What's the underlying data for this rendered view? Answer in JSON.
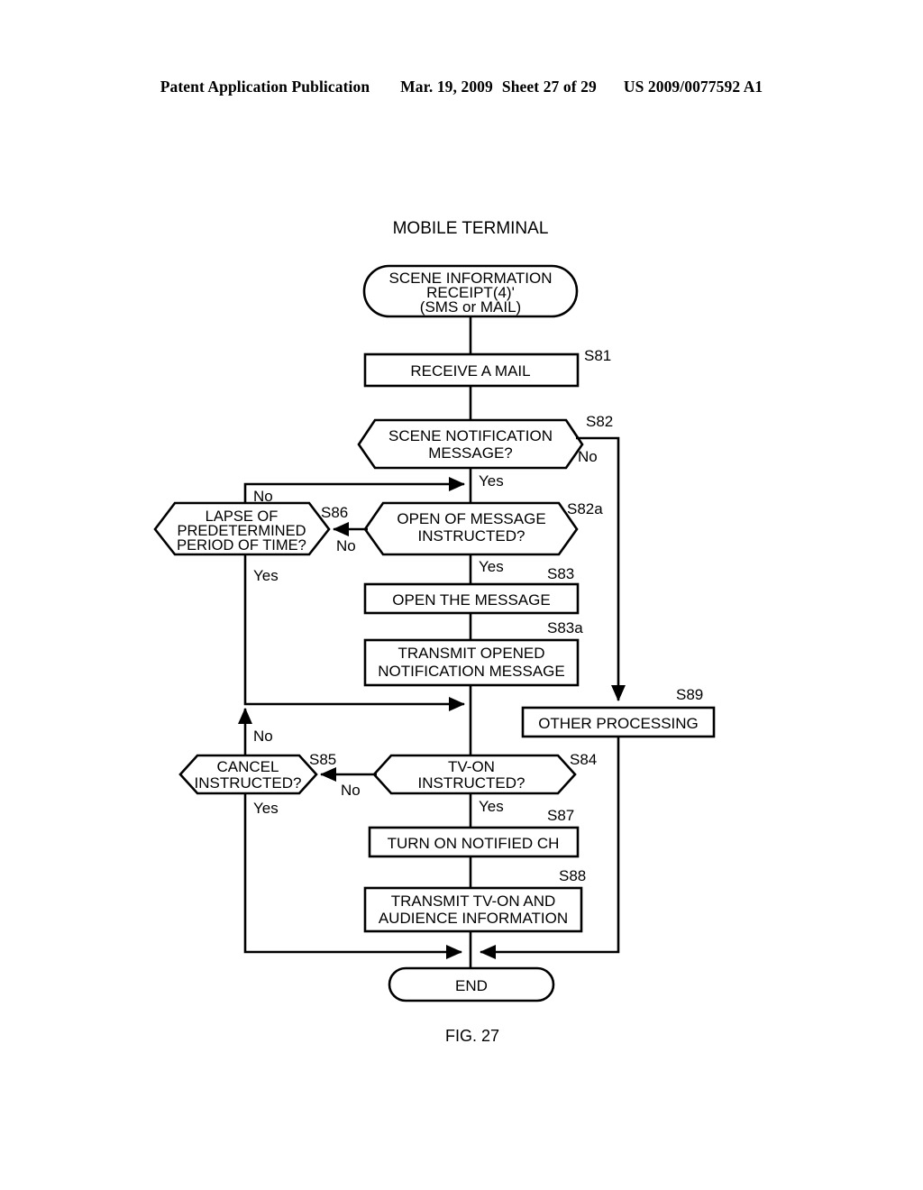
{
  "header": {
    "publication": "Patent Application Publication",
    "date": "Mar. 19, 2009",
    "sheet": "Sheet 27 of 29",
    "patent_number": "US 2009/0077592 A1"
  },
  "figure": {
    "caption": "FIG. 27",
    "column_title": "MOBILE TERMINAL"
  },
  "flowchart": {
    "type": "flowchart",
    "start": {
      "id": "start-terminal",
      "shape": "terminator",
      "lines": [
        "SCENE INFORMATION",
        "RECEIPT(4)'",
        "(SMS or MAIL)"
      ]
    },
    "end": {
      "id": "end-terminal",
      "shape": "terminator",
      "lines": [
        "END"
      ]
    },
    "nodes": [
      {
        "id": "s81",
        "step": "S81",
        "shape": "process",
        "lines": [
          "RECEIVE A MAIL"
        ]
      },
      {
        "id": "s82",
        "step": "S82",
        "shape": "decision",
        "lines": [
          "SCENE NOTIFICATION",
          "MESSAGE?"
        ]
      },
      {
        "id": "s82a",
        "step": "S82a",
        "shape": "decision",
        "lines": [
          "OPEN OF MESSAGE",
          "INSTRUCTED?"
        ]
      },
      {
        "id": "s86",
        "step": "S86",
        "shape": "decision",
        "lines": [
          "LAPSE OF",
          "PREDETERMINED",
          "PERIOD OF TIME?"
        ]
      },
      {
        "id": "s83",
        "step": "S83",
        "shape": "process",
        "lines": [
          "OPEN THE MESSAGE"
        ]
      },
      {
        "id": "s83a",
        "step": "S83a",
        "shape": "process",
        "lines": [
          "TRANSMIT OPENED",
          "NOTIFICATION MESSAGE"
        ]
      },
      {
        "id": "s89",
        "step": "S89",
        "shape": "process",
        "lines": [
          "OTHER PROCESSING"
        ]
      },
      {
        "id": "s84",
        "step": "S84",
        "shape": "decision",
        "lines": [
          "TV-ON",
          "INSTRUCTED?"
        ]
      },
      {
        "id": "s85",
        "step": "S85",
        "shape": "decision",
        "lines": [
          "CANCEL",
          "INSTRUCTED?"
        ]
      },
      {
        "id": "s87",
        "step": "S87",
        "shape": "process",
        "lines": [
          "TURN ON NOTIFIED CH"
        ]
      },
      {
        "id": "s88",
        "step": "S88",
        "shape": "process",
        "lines": [
          "TRANSMIT TV-ON AND",
          "AUDIENCE INFORMATION"
        ]
      }
    ],
    "branch_labels": {
      "s82_yes": "Yes",
      "s82_no": "No",
      "s82a_yes": "Yes",
      "s82a_no": "No",
      "s86_yes": "Yes",
      "s86_no": "No",
      "s84_yes": "Yes",
      "s84_no": "No",
      "s85_yes": "Yes",
      "s85_no": "No"
    },
    "edges": [
      {
        "from": "start-terminal",
        "to": "s81",
        "label": ""
      },
      {
        "from": "s81",
        "to": "s82",
        "label": ""
      },
      {
        "from": "s82",
        "to": "s82a",
        "label": "Yes"
      },
      {
        "from": "s82",
        "to": "s89",
        "label": "No"
      },
      {
        "from": "s82a",
        "to": "s83",
        "label": "Yes"
      },
      {
        "from": "s82a",
        "to": "s86",
        "label": "No"
      },
      {
        "from": "s86",
        "to": "s82a",
        "label": "No"
      },
      {
        "from": "s86",
        "to": "s84",
        "label": "Yes"
      },
      {
        "from": "s83",
        "to": "s83a",
        "label": ""
      },
      {
        "from": "s83a",
        "to": "s84",
        "label": ""
      },
      {
        "from": "s84",
        "to": "s87",
        "label": "Yes"
      },
      {
        "from": "s84",
        "to": "s85",
        "label": "No"
      },
      {
        "from": "s85",
        "to": "s84",
        "label": "No"
      },
      {
        "from": "s85",
        "to": "end-terminal",
        "label": "Yes"
      },
      {
        "from": "s87",
        "to": "s88",
        "label": ""
      },
      {
        "from": "s88",
        "to": "end-terminal",
        "label": ""
      },
      {
        "from": "s89",
        "to": "end-terminal",
        "label": ""
      }
    ]
  },
  "colors": {
    "ink": "#000000",
    "paper": "#ffffff"
  }
}
